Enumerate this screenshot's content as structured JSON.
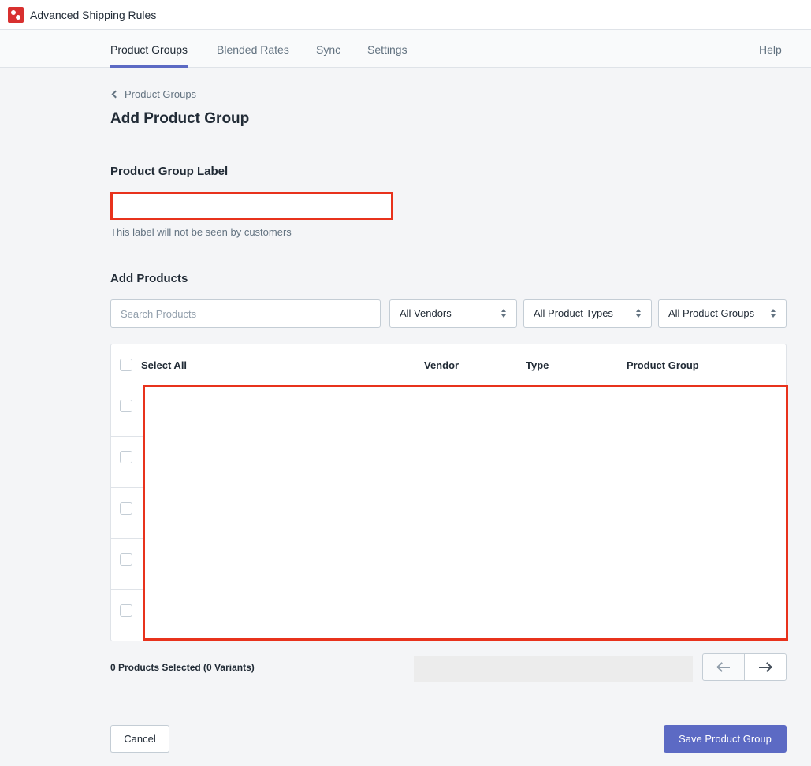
{
  "app": {
    "title": "Advanced Shipping Rules"
  },
  "nav": {
    "tabs": [
      {
        "label": "Product Groups",
        "active": true
      },
      {
        "label": "Blended Rates",
        "active": false
      },
      {
        "label": "Sync",
        "active": false
      },
      {
        "label": "Settings",
        "active": false
      }
    ],
    "help_label": "Help"
  },
  "breadcrumb": {
    "label": "Product Groups"
  },
  "page": {
    "title": "Add Product Group"
  },
  "label_section": {
    "heading": "Product Group Label",
    "value": "",
    "help_text": "This label will not be seen by customers"
  },
  "products_section": {
    "heading": "Add Products",
    "search_placeholder": "Search Products",
    "filters": {
      "vendor": "All Vendors",
      "product_type": "All Product Types",
      "product_group": "All Product Groups"
    },
    "table": {
      "select_all_label": "Select All",
      "columns": [
        "Vendor",
        "Type",
        "Product Group"
      ],
      "row_count": 5
    }
  },
  "footer": {
    "selected_text": "0 Products Selected (0 Variants)",
    "cancel_label": "Cancel",
    "save_label": "Save Product Group"
  },
  "colors": {
    "accent": "#5c6ac4",
    "redaction": "#e8321c",
    "primary_button": "#5c6ac4",
    "arrow_disabled": "#919eab",
    "arrow_enabled": "#454f5b"
  },
  "icons": {
    "app": "app-logo-icon",
    "back": "chevron-left-icon",
    "select": "select-arrows-icon",
    "prev": "arrow-left-icon",
    "next": "arrow-right-icon"
  }
}
